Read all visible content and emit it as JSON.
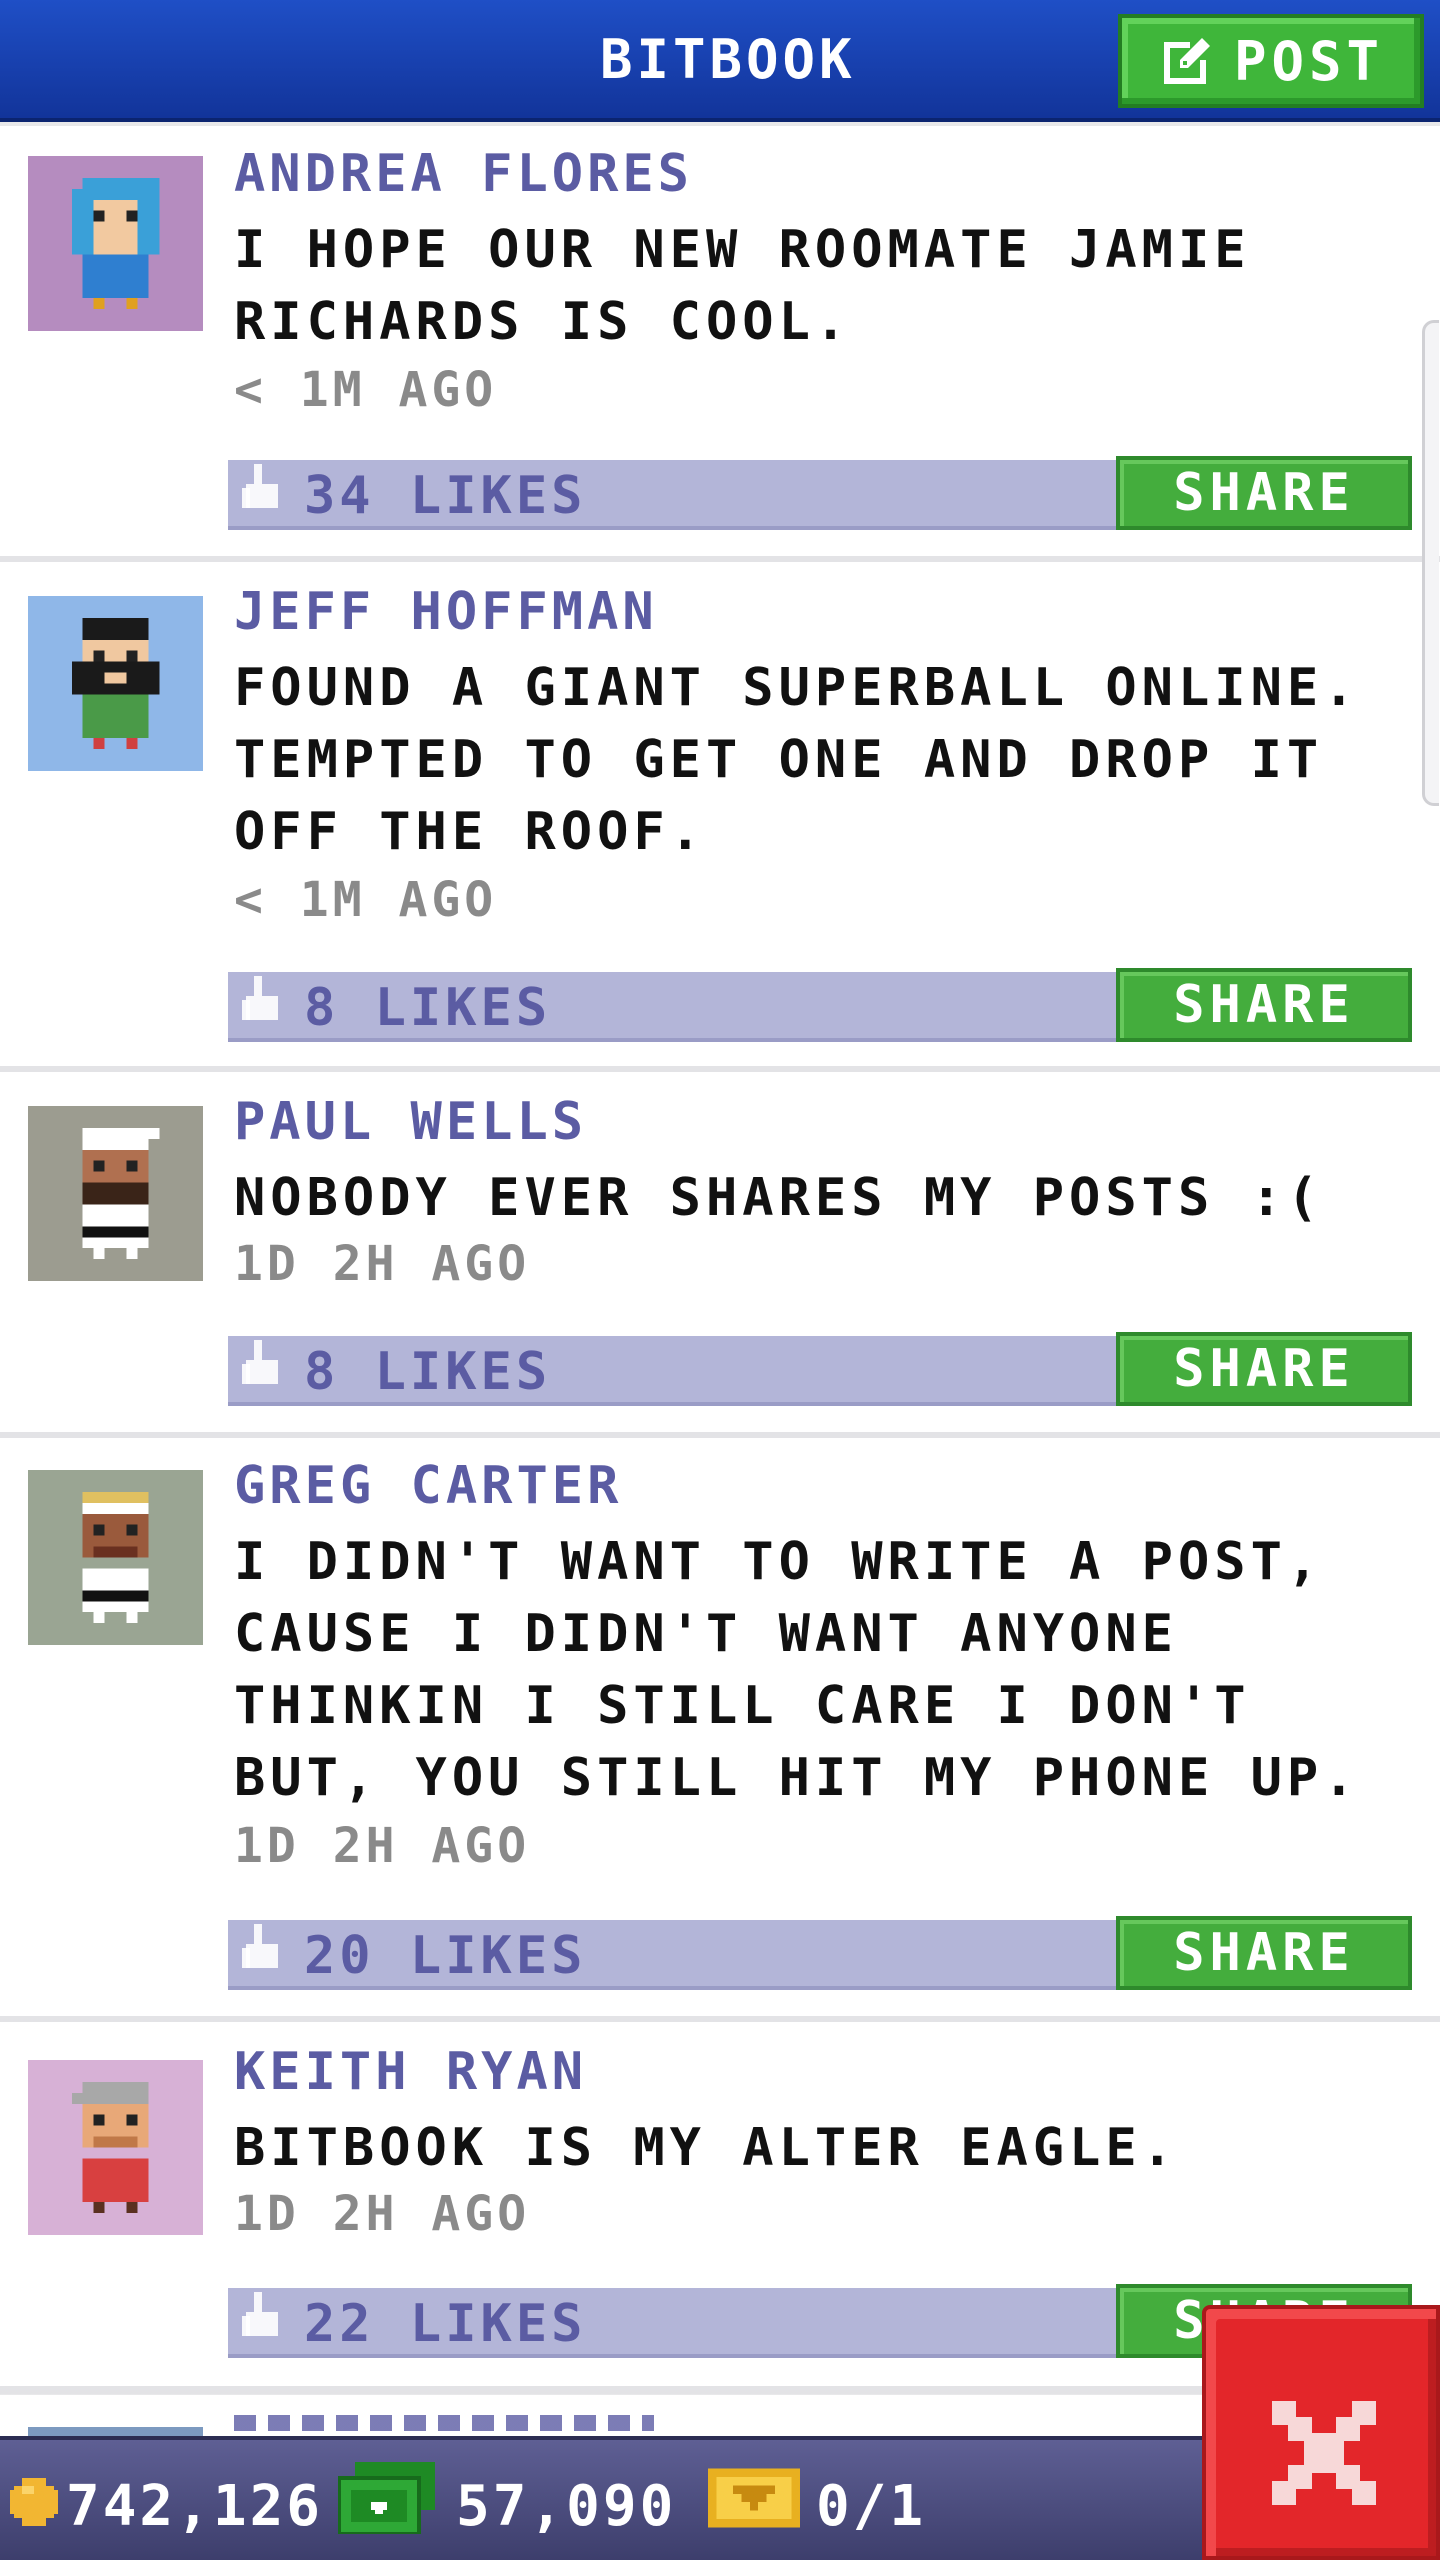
{
  "header": {
    "title": "BITBOOK",
    "post_label": "POST"
  },
  "posts": [
    {
      "author": "ANDREA FLORES",
      "message": "I HOPE OUR NEW ROOMATE JAMIE RICHARDS IS COOL.",
      "time": "< 1M AGO",
      "likes": "34 LIKES",
      "share": "SHARE",
      "avatar_bg": "#b58cbf"
    },
    {
      "author": "JEFF HOFFMAN",
      "message": "FOUND A GIANT SUPERBALL ONLINE. TEMPTED TO GET ONE AND DROP IT OFF THE ROOF.",
      "time": "< 1M AGO",
      "likes": "8 LIKES",
      "share": "SHARE",
      "avatar_bg": "#8fb7e8"
    },
    {
      "author": "PAUL WELLS",
      "message": "NOBODY EVER SHARES MY POSTS :(",
      "time": "1D 2H AGO",
      "likes": "8 LIKES",
      "share": "SHARE",
      "avatar_bg": "#9c9c90"
    },
    {
      "author": "GREG CARTER",
      "message": "I DIDN'T WANT TO WRITE A POST, CAUSE I DIDN'T WANT ANYONE THINKIN I STILL CARE I DON'T BUT, YOU STILL HIT MY PHONE UP.",
      "time": "1D 2H AGO",
      "likes": "20 LIKES",
      "share": "SHARE",
      "avatar_bg": "#9aa593"
    },
    {
      "author": "KEITH RYAN",
      "message": "BITBOOK IS MY ALTER EAGLE.",
      "time": "1D 2H AGO",
      "likes": "22 LIKES",
      "share": "SHARE",
      "avatar_bg": "#d7b1d6"
    }
  ],
  "footer": {
    "coins": "742,126",
    "bux": "57,090",
    "tickets": "0/1"
  },
  "colors": {
    "header_blue": "#1f4fc6",
    "share_green": "#44ad3d",
    "likes_bar": "#b3b5d8",
    "author_purple": "#5b5ca3",
    "close_red": "#e3262a"
  }
}
